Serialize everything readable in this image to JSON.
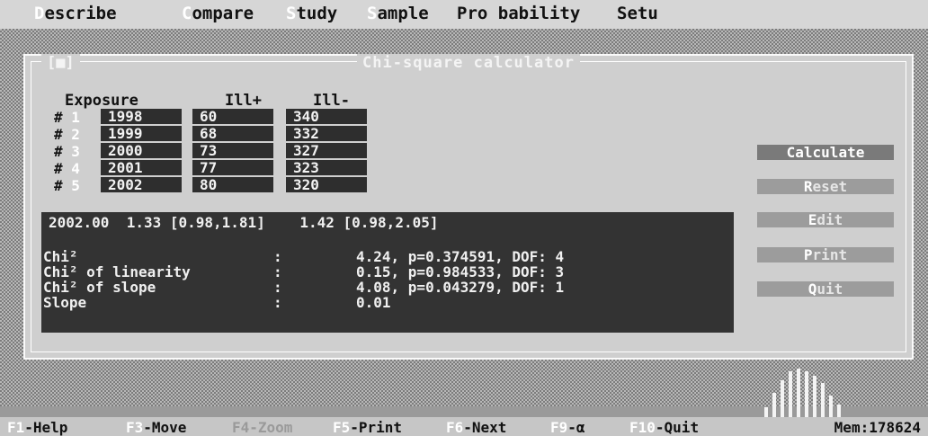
{
  "menu": [
    {
      "hot": "D",
      "rest": "escribe"
    },
    {
      "hot": "C",
      "rest": "ompare"
    },
    {
      "hot": "S",
      "rest": "tudy"
    },
    {
      "hot": "S",
      "rest": "ample"
    },
    {
      "hot": "Pro",
      "rest": "bability"
    },
    {
      "hot": "",
      "rest": "Setu"
    }
  ],
  "dialog": {
    "title": "Chi-square calculator",
    "left_label": "[■]"
  },
  "table": {
    "headers": {
      "exposure": "Exposure",
      "ill_pos": "Ill+",
      "ill_neg": "Ill-"
    },
    "rows": [
      {
        "num": "1",
        "exposure": "1998",
        "ill_pos": "60",
        "ill_neg": "340"
      },
      {
        "num": "2",
        "exposure": "1999",
        "ill_pos": "68",
        "ill_neg": "332"
      },
      {
        "num": "3",
        "exposure": "2000",
        "ill_pos": "73",
        "ill_neg": "327"
      },
      {
        "num": "4",
        "exposure": "2001",
        "ill_pos": "77",
        "ill_neg": "323"
      },
      {
        "num": "5",
        "exposure": "2002",
        "ill_pos": "80",
        "ill_neg": "320"
      }
    ]
  },
  "results": {
    "summary": "2002.00  1.33 [0.98,1.81]    1.42 [0.98,2.05]",
    "stats": [
      {
        "label": "Chi²",
        "sep": ":",
        "value": "4.24, p=0.374591, DOF: 4"
      },
      {
        "label": "Chi² of linearity",
        "sep": ":",
        "value": "0.15, p=0.984533, DOF: 3"
      },
      {
        "label": "Chi² of slope",
        "sep": ":",
        "value": "4.08, p=0.043279, DOF: 1"
      },
      {
        "label": "Slope",
        "sep": ":",
        "value": "0.01"
      }
    ]
  },
  "buttons": [
    {
      "hot": "",
      "rest": "Calculate"
    },
    {
      "hot": "R",
      "rest": "eset"
    },
    {
      "hot": "E",
      "rest": "dit"
    },
    {
      "hot": "P",
      "rest": "rint"
    },
    {
      "hot": "Q",
      "rest": "uit"
    }
  ],
  "histogram": [
    0.2,
    0.5,
    0.75,
    0.95,
    1.0,
    0.95,
    0.85,
    0.7,
    0.45,
    0.25
  ],
  "statusbar": {
    "keys": [
      {
        "key": "F1",
        "label": "-Help",
        "dim": false
      },
      {
        "key": "F3",
        "label": "-Move",
        "dim": false
      },
      {
        "key": "",
        "label": "F4-Zoom",
        "dim": true
      },
      {
        "key": "F5",
        "label": "-Print",
        "dim": false
      },
      {
        "key": "F6",
        "label": "-Next",
        "dim": false
      },
      {
        "key": "F9",
        "label": "-α",
        "dim": false
      },
      {
        "key": "F10",
        "label": "-Quit",
        "dim": false
      }
    ],
    "memory": "Mem:178624"
  },
  "colors": {
    "panel": "#333333",
    "dialog": "#cfcfcf",
    "button": "#9c9c9c"
  }
}
